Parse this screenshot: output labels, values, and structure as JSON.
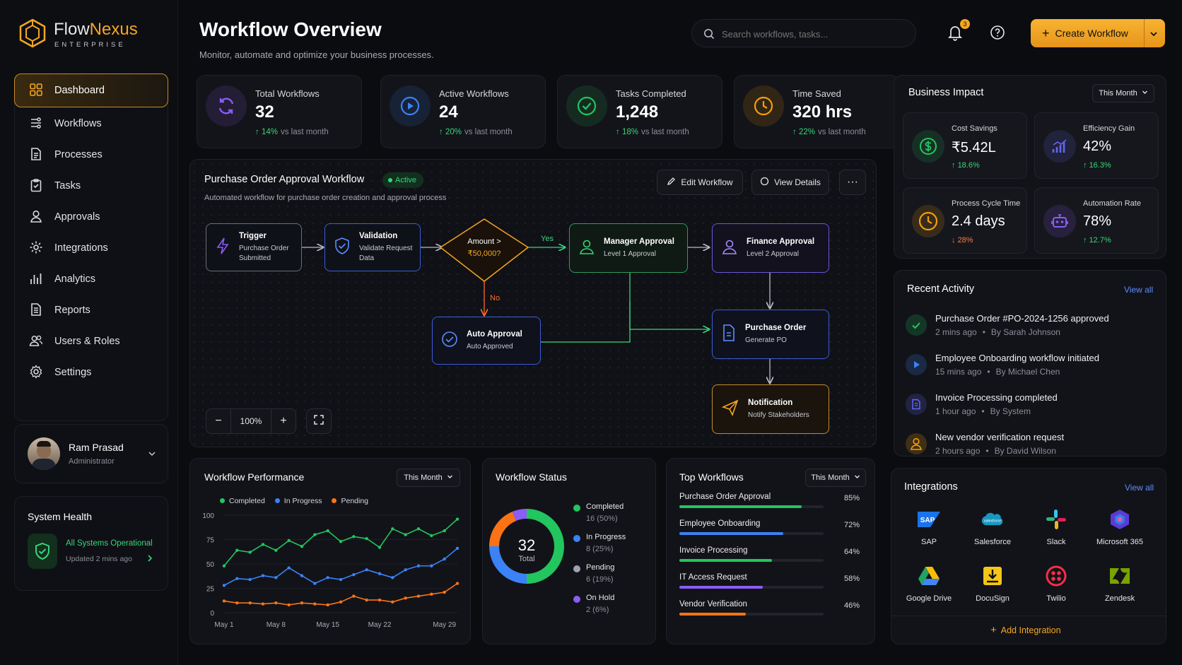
{
  "brand": {
    "name_a": "Flow",
    "name_b": "Nexus",
    "tagline": "ENTERPRISE"
  },
  "nav": [
    {
      "label": "Dashboard",
      "icon": "grid-icon"
    },
    {
      "label": "Workflows",
      "icon": "workflow-icon"
    },
    {
      "label": "Processes",
      "icon": "document-icon"
    },
    {
      "label": "Tasks",
      "icon": "clipboard-check-icon"
    },
    {
      "label": "Approvals",
      "icon": "user-icon"
    },
    {
      "label": "Integrations",
      "icon": "puzzle-gear-icon"
    },
    {
      "label": "Analytics",
      "icon": "bar-chart-icon"
    },
    {
      "label": "Reports",
      "icon": "report-icon"
    },
    {
      "label": "Users & Roles",
      "icon": "users-icon"
    },
    {
      "label": "Settings",
      "icon": "gear-icon"
    }
  ],
  "user": {
    "name": "Ram Prasad",
    "role": "Administrator"
  },
  "health": {
    "title": "System Health",
    "status": "All Systems Operational",
    "updated": "Updated 2 mins ago"
  },
  "header": {
    "title": "Workflow Overview",
    "subtitle": "Monitor, automate and optimize your business processes.",
    "search_placeholder": "Search workflows, tasks...",
    "notif_count": "3",
    "create_label": "Create Workflow"
  },
  "stats": [
    {
      "label": "Total Workflows",
      "value": "32",
      "delta": "14%",
      "delta_text": "vs last month",
      "icon": "refresh-icon",
      "color": "#8b5cf6"
    },
    {
      "label": "Active Workflows",
      "value": "24",
      "delta": "20%",
      "delta_text": "vs last month",
      "icon": "play-circle-icon",
      "color": "#3b82f6"
    },
    {
      "label": "Tasks Completed",
      "value": "1,248",
      "delta": "18%",
      "delta_text": "vs last month",
      "icon": "check-circle-icon",
      "color": "#22c55e"
    },
    {
      "label": "Time Saved",
      "value": "320 hrs",
      "delta": "22%",
      "delta_text": "vs last month",
      "icon": "clock-icon",
      "color": "#f59e0b"
    }
  ],
  "workflow": {
    "title": "Purchase Order Approval Workflow",
    "status": "Active",
    "desc": "Automated workflow for purchase order creation and approval process",
    "edit_label": "Edit Workflow",
    "view_label": "View Details",
    "zoom": "100%",
    "nodes": {
      "trigger": {
        "t": "Trigger",
        "s": "Purchase Order Submitted"
      },
      "validation": {
        "t": "Validation",
        "s": "Validate Request Data"
      },
      "decision": {
        "t": "Amount >",
        "s": "₹50,000?"
      },
      "manager": {
        "t": "Manager Approval",
        "s": "Level 1 Approval"
      },
      "finance": {
        "t": "Finance Approval",
        "s": "Level 2 Approval"
      },
      "auto": {
        "t": "Auto Approval",
        "s": "Auto Approved"
      },
      "po": {
        "t": "Purchase Order",
        "s": "Generate PO"
      },
      "notify": {
        "t": "Notification",
        "s": "Notify Stakeholders"
      }
    },
    "yes": "Yes",
    "no": "No"
  },
  "impact": {
    "title": "Business Impact",
    "period": "This Month",
    "items": [
      {
        "label": "Cost Savings",
        "value": "₹5.42L",
        "delta": "18.6%",
        "dir": "up",
        "icon": "dollar-icon",
        "color": "#22c55e"
      },
      {
        "label": "Efficiency Gain",
        "value": "42%",
        "delta": "16.3%",
        "dir": "up",
        "icon": "signal-icon",
        "color": "#6366f1"
      },
      {
        "label": "Process Cycle Time",
        "value": "2.4 days",
        "delta": "28%",
        "dir": "down",
        "icon": "clock-icon",
        "color": "#f59e0b"
      },
      {
        "label": "Automation Rate",
        "value": "78%",
        "delta": "12.7%",
        "dir": "up",
        "icon": "robot-icon",
        "color": "#8b5cf6"
      }
    ]
  },
  "activity": {
    "title": "Recent Activity",
    "view_all": "View all",
    "items": [
      {
        "title": "Purchase Order #PO-2024-1256 approved",
        "time": "2 mins ago",
        "by": "By Sarah Johnson",
        "icon": "check-icon",
        "color": "#22c55e"
      },
      {
        "title": "Employee Onboarding workflow initiated",
        "time": "15 mins ago",
        "by": "By Michael Chen",
        "icon": "play-icon",
        "color": "#3b82f6"
      },
      {
        "title": "Invoice Processing completed",
        "time": "1 hour ago",
        "by": "By System",
        "icon": "invoice-icon",
        "color": "#6366f1"
      },
      {
        "title": "New vendor verification request",
        "time": "2 hours ago",
        "by": "By David Wilson",
        "icon": "user-icon",
        "color": "#f59e0b"
      }
    ]
  },
  "integrations": {
    "title": "Integrations",
    "view_all": "View all",
    "add_label": "Add Integration",
    "items": [
      {
        "label": "SAP",
        "icon": "sap-icon"
      },
      {
        "label": "Salesforce",
        "icon": "salesforce-icon"
      },
      {
        "label": "Slack",
        "icon": "slack-icon"
      },
      {
        "label": "Microsoft 365",
        "icon": "microsoft365-icon"
      },
      {
        "label": "Google Drive",
        "icon": "google-drive-icon"
      },
      {
        "label": "DocuSign",
        "icon": "docusign-icon"
      },
      {
        "label": "Twilio",
        "icon": "twilio-icon"
      },
      {
        "label": "Zendesk",
        "icon": "zendesk-icon"
      }
    ]
  },
  "performance": {
    "title": "Workflow Performance",
    "period": "This Month",
    "chart_data": {
      "type": "line",
      "x": [
        "May 1",
        "May 3",
        "May 5",
        "May 7",
        "May 8",
        "May 10",
        "May 12",
        "May 13",
        "May 15",
        "May 17",
        "May 19",
        "May 21",
        "May 22",
        "May 24",
        "May 25",
        "May 27",
        "May 28",
        "May 29",
        "May 30"
      ],
      "xticks": [
        "May 1",
        "May 8",
        "May 15",
        "May 22",
        "May 29"
      ],
      "ylim": [
        0,
        100
      ],
      "yticks": [
        100,
        75,
        50,
        25,
        0
      ],
      "series": [
        {
          "name": "Completed",
          "color": "#22c55e",
          "values": [
            48,
            64,
            62,
            70,
            64,
            74,
            68,
            80,
            84,
            73,
            78,
            76,
            67,
            86,
            80,
            86,
            79,
            84,
            96
          ]
        },
        {
          "name": "In Progress",
          "color": "#3b82f6",
          "values": [
            28,
            35,
            34,
            38,
            36,
            46,
            38,
            30,
            36,
            34,
            39,
            44,
            40,
            36,
            44,
            48,
            48,
            55,
            66
          ]
        },
        {
          "name": "Pending",
          "color": "#f97316",
          "values": [
            12,
            10,
            10,
            9,
            10,
            8,
            10,
            9,
            8,
            11,
            17,
            13,
            13,
            11,
            15,
            17,
            19,
            21,
            30
          ]
        }
      ]
    }
  },
  "status": {
    "title": "Workflow Status",
    "total": "32",
    "total_label": "Total",
    "chart_data": {
      "type": "pie",
      "labels": [
        "Completed",
        "In Progress",
        "Pending",
        "On Hold"
      ],
      "values": [
        16,
        8,
        6,
        2
      ],
      "colors": [
        "#22c55e",
        "#3b82f6",
        "#f97316",
        "#8b5cf6"
      ]
    },
    "legend": [
      {
        "label": "Completed",
        "detail": "16 (50%)",
        "color": "#22c55e"
      },
      {
        "label": "In Progress",
        "detail": "8 (25%)",
        "color": "#3b82f6"
      },
      {
        "label": "Pending",
        "detail": "6 (19%)",
        "color": "#9ca3af"
      },
      {
        "label": "On Hold",
        "detail": "2 (6%)",
        "color": "#8b5cf6"
      }
    ]
  },
  "top": {
    "title": "Top Workflows",
    "period": "This Month",
    "chart_data": {
      "type": "bar",
      "categories": [
        "Purchase Order Approval",
        "Employee Onboarding",
        "Invoice Processing",
        "IT Access Request",
        "Vendor Verification"
      ],
      "values": [
        85,
        72,
        64,
        58,
        46
      ],
      "colors": [
        "#22c55e",
        "#3b82f6",
        "#22c55e",
        "#8b5cf6",
        "#f97316"
      ]
    },
    "pct": [
      "85%",
      "72%",
      "64%",
      "58%",
      "46%"
    ]
  }
}
